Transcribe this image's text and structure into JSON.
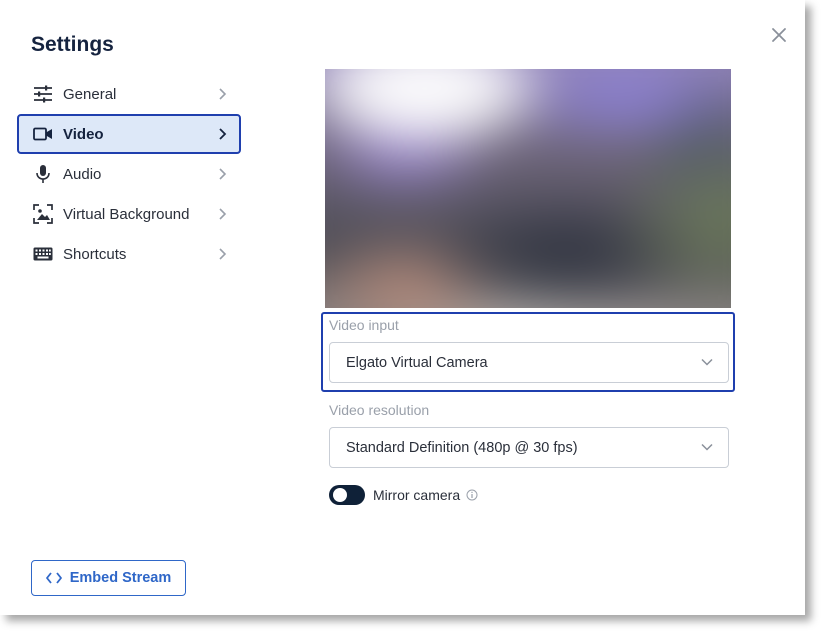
{
  "dialog": {
    "title": "Settings"
  },
  "nav": {
    "items": [
      {
        "label": "General",
        "icon": "sliders-icon"
      },
      {
        "label": "Video",
        "icon": "video-camera-icon",
        "active": true
      },
      {
        "label": "Audio",
        "icon": "microphone-icon"
      },
      {
        "label": "Virtual Background",
        "icon": "image-frame-icon"
      },
      {
        "label": "Shortcuts",
        "icon": "keyboard-icon"
      }
    ]
  },
  "video": {
    "input_label": "Video input",
    "input_value": "Elgato Virtual Camera",
    "resolution_label": "Video resolution",
    "resolution_value": "Standard Definition (480p @ 30 fps)",
    "mirror_label": "Mirror camera",
    "mirror_enabled": false
  },
  "footer": {
    "embed_label": "Embed Stream"
  },
  "colors": {
    "accent": "#2f67c8",
    "focus_border": "#1f3fae",
    "active_bg": "#dde8f8",
    "toggle_bg": "#0f2138"
  }
}
